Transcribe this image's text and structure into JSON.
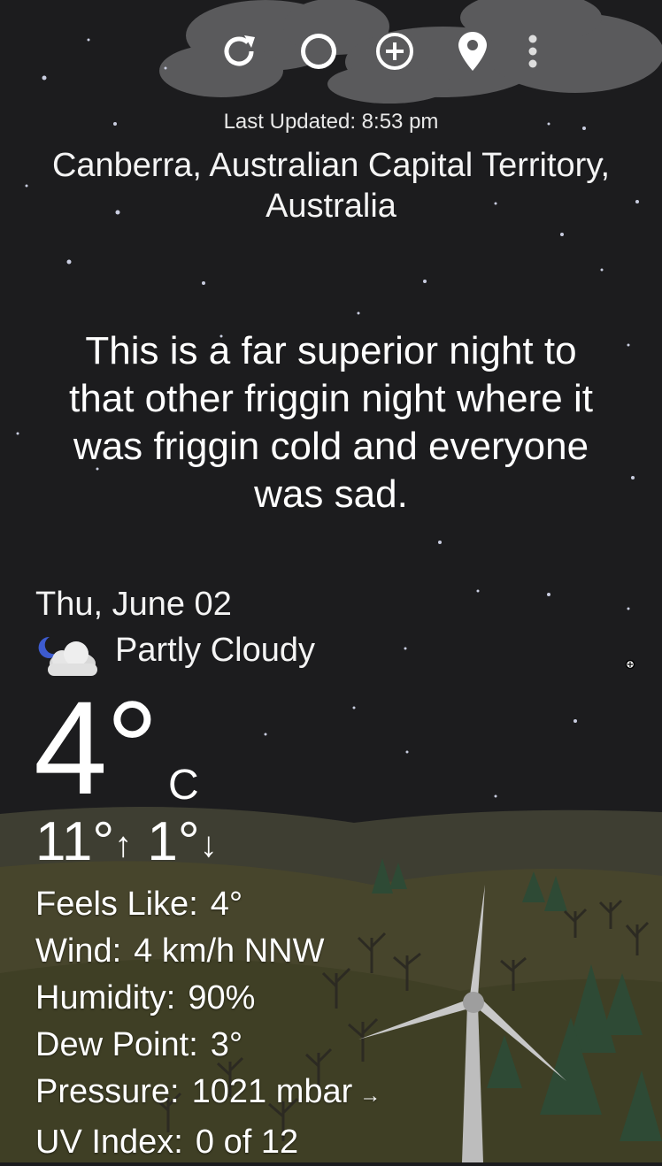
{
  "toolbar": {
    "refresh_icon": "refresh-icon",
    "moon_icon": "moon-phase-icon",
    "add_icon": "add-location-icon",
    "pin_icon": "location-pin-icon",
    "menu_icon": "overflow-menu-icon"
  },
  "header": {
    "last_updated": "Last Updated: 8:53 pm",
    "location_line1": "Canberra, Australian Capital Territory,",
    "location_line2": "Australia"
  },
  "message": {
    "line1": "This is a far superior night to",
    "line2": "that other friggin night where it",
    "line3": "was friggin cold and everyone",
    "line4": "was sad."
  },
  "current": {
    "date": "Thu, June 02",
    "condition": "Partly Cloudy",
    "condition_icon": "partly-cloudy-night-icon",
    "temp": "4°",
    "unit": "C",
    "high": "11°",
    "low": "1°",
    "up_arrow": "↑",
    "down_arrow": "↓"
  },
  "details": {
    "feels_like_label": "Feels Like:",
    "feels_like_value": "4°",
    "wind_label": "Wind:",
    "wind_value": "4 km/h NNW",
    "humidity_label": "Humidity:",
    "humidity_value": "90%",
    "dew_point_label": "Dew Point:",
    "dew_point_value": "3°",
    "pressure_label": "Pressure:",
    "pressure_value": "1021 mbar",
    "pressure_trend": "→",
    "uv_label": "UV Index:",
    "uv_value": "0 of 12"
  },
  "colors": {
    "sky": "#1c1c1e",
    "hills": "#4a4a2e",
    "cloud": "#5a5a5c",
    "text": "#ffffff"
  }
}
